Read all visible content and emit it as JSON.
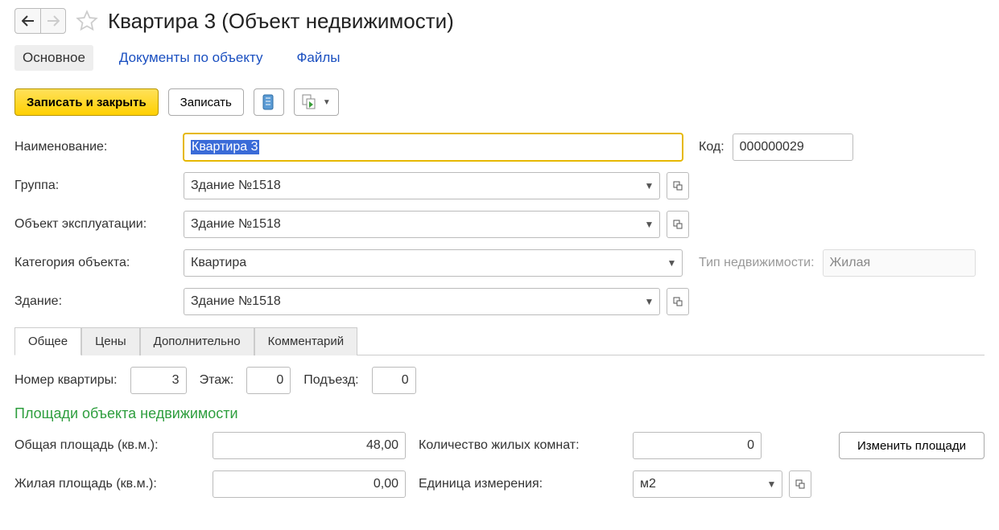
{
  "header": {
    "title": "Квартира 3 (Объект недвижимости)"
  },
  "navTabs": {
    "main": "Основное",
    "docs": "Документы по объекту",
    "files": "Файлы"
  },
  "toolbar": {
    "saveClose": "Записать и закрыть",
    "save": "Записать"
  },
  "fields": {
    "nameLabel": "Наименование:",
    "nameValue": "Квартира 3",
    "codeLabel": "Код:",
    "codeValue": "000000029",
    "groupLabel": "Группа:",
    "groupValue": "Здание №1518",
    "exploitLabel": "Объект эксплуатации:",
    "exploitValue": "Здание №1518",
    "categoryLabel": "Категория объекта:",
    "categoryValue": "Квартира",
    "realtyTypeLabel": "Тип недвижимости:",
    "realtyTypeValue": "Жилая",
    "buildingLabel": "Здание:",
    "buildingValue": "Здание №1518"
  },
  "subtabs": {
    "general": "Общее",
    "prices": "Цены",
    "extra": "Дополнительно",
    "comment": "Комментарий"
  },
  "general": {
    "aptNumLabel": "Номер квартиры:",
    "aptNumValue": "3",
    "floorLabel": "Этаж:",
    "floorValue": "0",
    "entranceLabel": "Подъезд:",
    "entranceValue": "0",
    "areasTitle": "Площади объекта недвижимости",
    "totalAreaLabel": "Общая площадь (кв.м.):",
    "totalAreaValue": "48,00",
    "roomsLabel": "Количество жилых комнат:",
    "roomsValue": "0",
    "changeAreasBtn": "Изменить площади",
    "livingAreaLabel": "Жилая площадь (кв.м.):",
    "livingAreaValue": "0,00",
    "unitLabel": "Единица измерения:",
    "unitValue": "м2"
  }
}
